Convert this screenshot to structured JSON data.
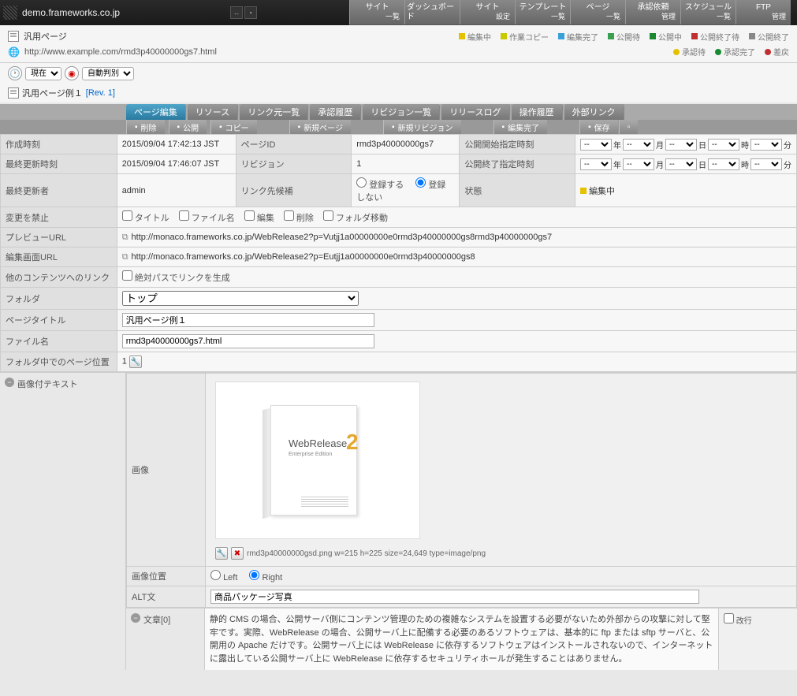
{
  "site_name": "demo.frameworks.co.jp",
  "topnav": [
    {
      "t1": "サイト",
      "t2": "一覧"
    },
    {
      "t1": "ダッシュボード",
      "t2": ""
    },
    {
      "t1": "サイト",
      "t2": "設定"
    },
    {
      "t1": "テンプレート",
      "t2": "一覧"
    },
    {
      "t1": "ページ",
      "t2": "一覧"
    },
    {
      "t1": "承認依頼",
      "t2": "管理"
    },
    {
      "t1": "スケジュール",
      "t2": "一覧"
    },
    {
      "t1": "FTP",
      "t2": "管理"
    }
  ],
  "page_type": "汎用ページ",
  "page_url": "http://www.example.com/rmd3p40000000gs7.html",
  "status_legend": [
    {
      "c": "#e5c100",
      "l": "編集中"
    },
    {
      "c": "#c9c900",
      "l": "作業コピー"
    },
    {
      "c": "#3aa0d8",
      "l": "編集完了"
    },
    {
      "c": "#3aa050",
      "l": "公開待"
    },
    {
      "c": "#1a8a30",
      "l": "公開中"
    },
    {
      "c": "#c03030",
      "l": "公開終了待"
    },
    {
      "c": "#888",
      "l": "公開終了"
    }
  ],
  "approve_legend": [
    {
      "c": "#e5c100",
      "l": "承認待"
    },
    {
      "c": "#1a8a30",
      "l": "承認完了"
    },
    {
      "c": "#c03030",
      "l": "差戻"
    }
  ],
  "time_sel": "現在",
  "judge_sel": "自動判別",
  "rev_title": "汎用ページ例１",
  "rev_no": "[Rev. 1]",
  "tabs": [
    "ページ編集",
    "リソース",
    "リンク元一覧",
    "承認履歴",
    "リビジョン一覧",
    "リリースログ",
    "操作履歴",
    "外部リンク"
  ],
  "actions": [
    "削除",
    "公開",
    "コピー",
    "新規ページ",
    "新規リビジョン",
    "編集完了",
    "保存"
  ],
  "fields": {
    "created_label": "作成時刻",
    "created": "2015/09/04 17:42:13 JST",
    "pageid_label": "ページID",
    "pageid": "rmd3p40000000gs7",
    "pubstart_label": "公開開始指定時刻",
    "updated_label": "最終更新時刻",
    "updated": "2015/09/04 17:46:07 JST",
    "revision_label": "リビジョン",
    "revision": "1",
    "pubend_label": "公開終了指定時刻",
    "updater_label": "最終更新者",
    "updater": "admin",
    "linkcand_label": "リンク先候補",
    "linkcand_reg": "登録する",
    "linkcand_noreg": "登録しない",
    "state_label": "状態",
    "state_val": "編集中",
    "forbid_label": "変更を禁止",
    "forbid_opts": [
      "タイトル",
      "ファイル名",
      "編集",
      "削除",
      "フォルダ移動"
    ],
    "preview_label": "プレビューURL",
    "preview_url": "http://monaco.frameworks.co.jp/WebRelease2?p=Vutjj1a00000000e0rmd3p40000000gs8rmd3p40000000gs7",
    "editurl_label": "編集画面URL",
    "edit_url": "http://monaco.frameworks.co.jp/WebRelease2?p=Eutjj1a00000000e0rmd3p40000000gs8",
    "otherlinks_label": "他のコンテンツへのリンク",
    "otherlinks_opt": "絶対パスでリンクを生成",
    "folder_label": "フォルダ",
    "folder_val": "トップ",
    "title_label": "ページタイトル",
    "title_val": "汎用ページ例１",
    "fname_label": "ファイル名",
    "fname_val": "rmd3p40000000gs7.html",
    "pos_label": "フォルダ中でのページ位置",
    "pos_val": "1"
  },
  "date_units": [
    "年",
    "月",
    "日",
    "時",
    "分"
  ],
  "date_placeholder": "--",
  "block_label": "画像付テキスト",
  "img_label": "画像",
  "img_meta": "rmd3p40000000gsd.png w=215 h=225 size=24,649 type=image/png",
  "imgbox": {
    "brand": "WebRelease",
    "num": "2",
    "sub": "Enterprise Edition"
  },
  "imgpos_label": "画像位置",
  "imgpos_left": "Left",
  "imgpos_right": "Right",
  "alt_label": "ALT文",
  "alt_val": "商品パッケージ写真",
  "article_label": "文章[0]",
  "article_body": "静的 CMS の場合、公開サーバ側にコンテンツ管理のための複雑なシステムを設置する必要がないため外部からの攻撃に対して堅牢です。実際、WebRelease の場合、公開サーバ上に配備する必要のあるソフトウェアは、基本的に ftp または sftp サーバと、公開用の Apache だけです。公開サーバ上には WebRelease に依存するソフトウェアはインストールされないので、インターネットに露出している公開サーバ上に WebRelease に依存するセキュリティホールが発生することはありません。",
  "article_break": "改行"
}
